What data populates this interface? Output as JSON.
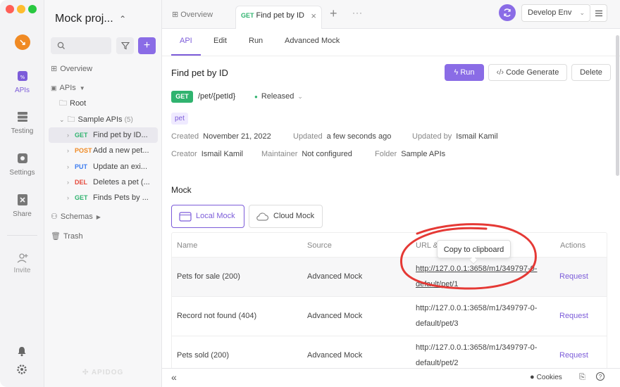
{
  "rail": {
    "items": [
      {
        "label": "APIs",
        "icon": "apis-icon"
      },
      {
        "label": "Testing",
        "icon": "testing-icon"
      },
      {
        "label": "Settings",
        "icon": "settings-icon"
      },
      {
        "label": "Share",
        "icon": "share-icon"
      },
      {
        "label": "Invite",
        "icon": "invite-icon"
      }
    ]
  },
  "sidebar": {
    "project_name": "Mock proj...",
    "overview": "Overview",
    "apis": "APIs",
    "root": "Root",
    "folder": "Sample APIs",
    "folder_count": "(5)",
    "endpoints": [
      {
        "method": "GET",
        "name": "Find pet by ID..."
      },
      {
        "method": "POST",
        "name": "Add a new pet..."
      },
      {
        "method": "PUT",
        "name": "Update an exi..."
      },
      {
        "method": "DEL",
        "name": "Deletes a pet (..."
      },
      {
        "method": "GET",
        "name": "Finds Pets by ..."
      }
    ],
    "schemas": "Schemas",
    "trash": "Trash",
    "watermark": "APIDOG"
  },
  "tabbar": {
    "overview_tab": "Overview",
    "active_tab_method": "GET",
    "active_tab_label": "Find pet by ID",
    "env": "Develop Env"
  },
  "subtabs": [
    "API",
    "Edit",
    "Run",
    "Advanced Mock"
  ],
  "api": {
    "title": "Find pet by ID",
    "run_label": "Run",
    "codegen_label": "Code Generate",
    "delete_label": "Delete",
    "method": "GET",
    "path": "/pet/{petId}",
    "status": "Released",
    "tag": "pet",
    "created_key": "Created",
    "created_val": "November 21, 2022",
    "updated_key": "Updated",
    "updated_val": "a few seconds ago",
    "updated_by_key": "Updated by",
    "updated_by_val": "Ismail Kamil",
    "creator_key": "Creator",
    "creator_val": "Ismail Kamil",
    "maintainer_key": "Maintainer",
    "maintainer_val": "Not configured",
    "folder_key": "Folder",
    "folder_val": "Sample APIs"
  },
  "mock": {
    "heading": "Mock",
    "local_label": "Local Mock",
    "cloud_label": "Cloud Mock",
    "columns": [
      "Name",
      "Source",
      "URL &",
      "Actions"
    ],
    "rows": [
      {
        "name": "Pets for sale (200)",
        "source": "Advanced Mock",
        "url": "http://127.0.0.1:3658/m1/349797-0-default/pet/1",
        "action": "Request"
      },
      {
        "name": "Record not found (404)",
        "source": "Advanced Mock",
        "url": "http://127.0.0.1:3658/m1/349797-0-default/pet/3",
        "action": "Request"
      },
      {
        "name": "Pets sold (200)",
        "source": "Advanced Mock",
        "url": "http://127.0.0.1:3658/m1/349797-0-default/pet/2",
        "action": "Request"
      }
    ],
    "tooltip": "Copy to clipboard"
  },
  "footer": {
    "collapse": "«",
    "cookies": "Cookies"
  },
  "colors": {
    "accent": "#7c5cd9",
    "get": "#30b36f",
    "post": "#f08a24",
    "put": "#3c7cf0",
    "del": "#e5483b",
    "annotation": "#e53935"
  }
}
